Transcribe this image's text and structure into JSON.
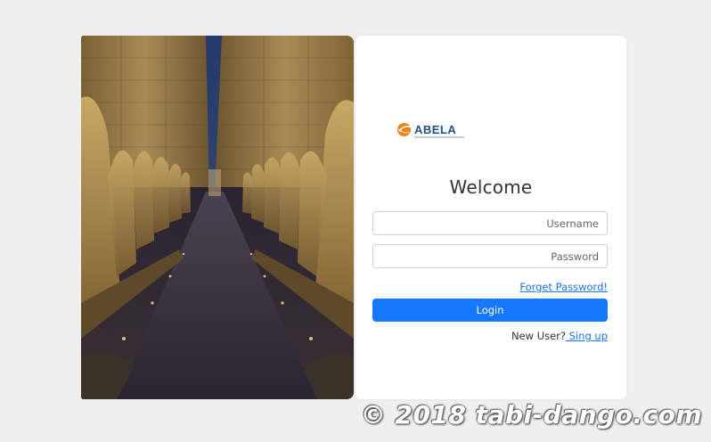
{
  "brand": {
    "logo_text": "ABELA",
    "accent_color": "#f0821e",
    "text_color": "#1f4f8a"
  },
  "login": {
    "heading": "Welcome",
    "username_placeholder": "Username",
    "password_placeholder": "Password",
    "forgot_label": "Forget Password!",
    "login_label": "Login",
    "new_user_text": "New User?",
    "signup_label": " Sing up",
    "button_color": "#1677ff",
    "link_color": "#1e73e8"
  },
  "watermark": {
    "text": "© 2018 tabi-dango.com"
  }
}
